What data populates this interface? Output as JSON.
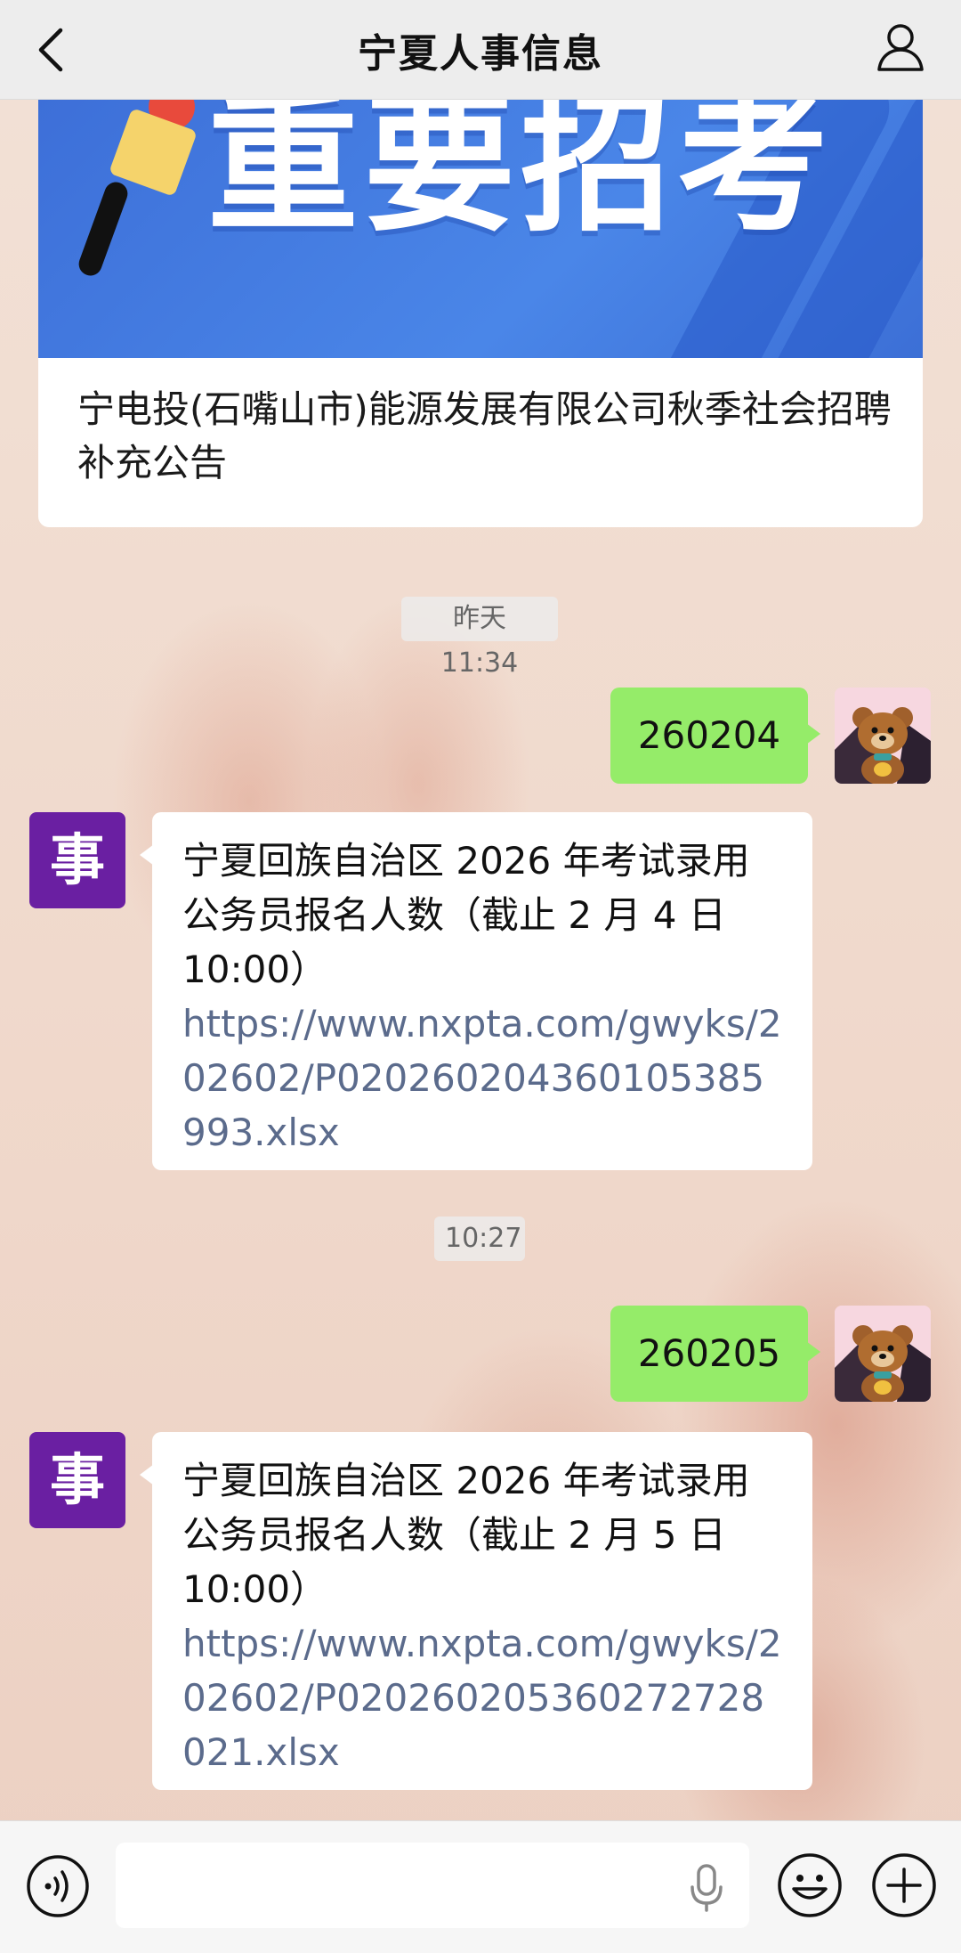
{
  "header": {
    "title": "宁夏人事信息",
    "back_icon": "chevron-left-icon",
    "profile_icon": "person-icon"
  },
  "article": {
    "banner_text": "重要招考",
    "title": "宁电投(石嘴山市)能源发展有限公司秋季社会招聘补充公告",
    "banner_color": "#4a86e8"
  },
  "messages": [
    {
      "type": "time",
      "text": "昨天 11:34"
    },
    {
      "type": "sent",
      "text": "260204"
    },
    {
      "type": "received",
      "avatar_text": "事",
      "text": "宁夏回族自治区 2026 年考试录用公务员报名人数（截止 2 月 4 日 10:00）",
      "link": "https://www.nxpta.com/gwyks/202602/P020260204360105385993.xlsx"
    },
    {
      "type": "time",
      "text": "10:27"
    },
    {
      "type": "sent",
      "text": "260205"
    },
    {
      "type": "received",
      "avatar_text": "事",
      "text": "宁夏回族自治区 2026 年考试录用公务员报名人数（截止 2 月 5 日 10:00）",
      "link": "https://www.nxpta.com/gwyks/202602/P020260205360272728021.xlsx"
    }
  ],
  "input_bar": {
    "placeholder": "",
    "voice_icon": "voice-mode-icon",
    "mic_icon": "microphone-icon",
    "emoji_icon": "emoji-icon",
    "plus_icon": "plus-icon"
  },
  "colors": {
    "sent_bubble": "#95ec69",
    "bot_avatar": "#6a1fa2",
    "link": "#5b6b8c"
  }
}
